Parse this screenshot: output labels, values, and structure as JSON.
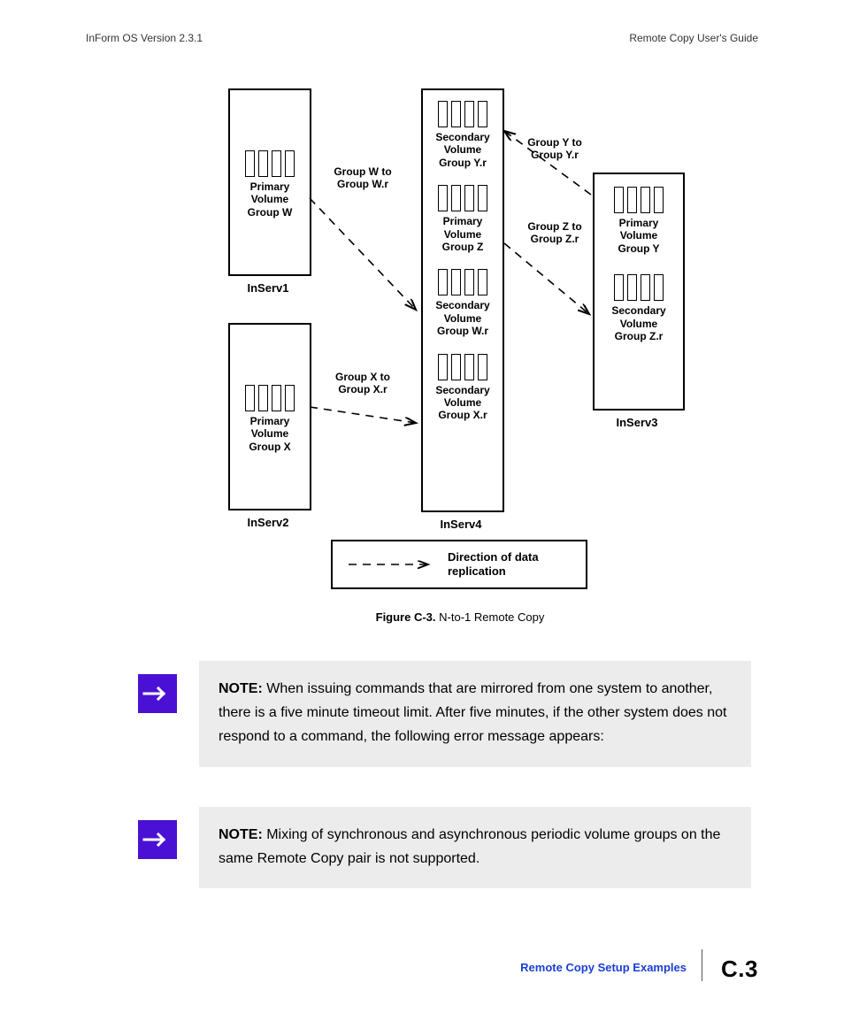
{
  "header": {
    "left": "InForm OS Version 2.3.1",
    "right": "Remote Copy User's Guide"
  },
  "servers": {
    "inserv1": {
      "label": "InServ1",
      "groups": [
        {
          "l1": "Primary",
          "l2": "Volume",
          "l3": "Group W"
        }
      ]
    },
    "inserv2": {
      "label": "InServ2",
      "groups": [
        {
          "l1": "Primary",
          "l2": "Volume",
          "l3": "Group X"
        }
      ]
    },
    "inserv3": {
      "label": "InServ3",
      "groups": [
        {
          "l1": "Primary",
          "l2": "Volume",
          "l3": "Group Y"
        },
        {
          "l1": "Secondary",
          "l2": "Volume",
          "l3": "Group Z.r"
        }
      ]
    },
    "inserv4": {
      "label": "InServ4",
      "groups": [
        {
          "l1": "Secondary",
          "l2": "Volume",
          "l3": "Group Y.r"
        },
        {
          "l1": "Primary",
          "l2": "Volume",
          "l3": "Group Z"
        },
        {
          "l1": "Secondary",
          "l2": "Volume",
          "l3": "Group W.r"
        },
        {
          "l1": "Secondary",
          "l2": "Volume",
          "l3": "Group X.r"
        }
      ]
    }
  },
  "arrows": {
    "w": {
      "l1": "Group W to",
      "l2": "Group W.r"
    },
    "x": {
      "l1": "Group X to",
      "l2": "Group X.r"
    },
    "y": {
      "l1": "Group Y to",
      "l2": "Group Y.r"
    },
    "z": {
      "l1": "Group Z to",
      "l2": "Group Z.r"
    }
  },
  "legend": "Direction of data replication",
  "figure": {
    "tag": "Figure C-3.",
    "title": "N-to-1 Remote Copy"
  },
  "notes": {
    "n1_label": "NOTE:",
    "n1_text": " When issuing commands that are mirrored from one system to another, there is a five minute timeout limit. After five minutes, if the other system does not respond to a command, the following error message appears:",
    "n2_label": "NOTE:",
    "n2_text": " Mixing of synchronous and asynchronous periodic volume groups on the same Remote Copy pair is not supported."
  },
  "footer": {
    "link": "Remote Copy Setup Examples",
    "page": "C.3"
  }
}
